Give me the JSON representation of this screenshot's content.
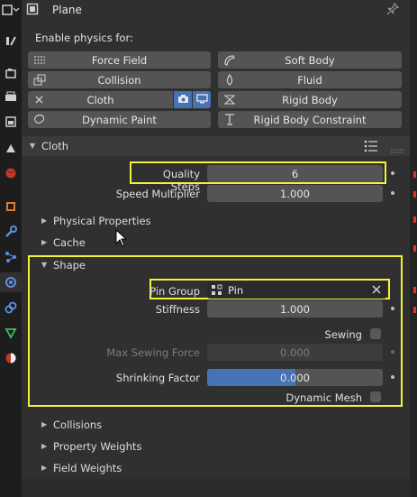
{
  "header": {
    "title": "Plane"
  },
  "physics": {
    "enable_label": "Enable physics for:",
    "buttons": {
      "force_field": "Force Field",
      "soft_body": "Soft Body",
      "collision": "Collision",
      "fluid": "Fluid",
      "cloth": "Cloth",
      "rigid_body": "Rigid Body",
      "dynamic_paint": "Dynamic Paint",
      "rigid_body_constraint": "Rigid Body Constraint"
    }
  },
  "cloth": {
    "title": "Cloth",
    "quality_steps_label": "Quality Steps",
    "quality_steps_value": "6",
    "speed_multiplier_label": "Speed Multiplier",
    "speed_multiplier_value": "1.000",
    "physical_properties": "Physical Properties",
    "cache": "Cache",
    "shape": {
      "title": "Shape",
      "pin_group_label": "Pin Group",
      "pin_group_value": "Pin",
      "stiffness_label": "Stiffness",
      "stiffness_value": "1.000",
      "sewing_label": "Sewing",
      "max_sewing_force_label": "Max Sewing Force",
      "max_sewing_force_value": "0.000",
      "shrinking_factor_label": "Shrinking Factor",
      "shrinking_factor_value": "0.000",
      "dynamic_mesh_label": "Dynamic Mesh"
    },
    "collisions": "Collisions",
    "property_weights": "Property Weights",
    "field_weights": "Field Weights"
  },
  "colors": {
    "highlight": "#f2f23a",
    "accent": "#4772b3",
    "panel": "#303030"
  }
}
